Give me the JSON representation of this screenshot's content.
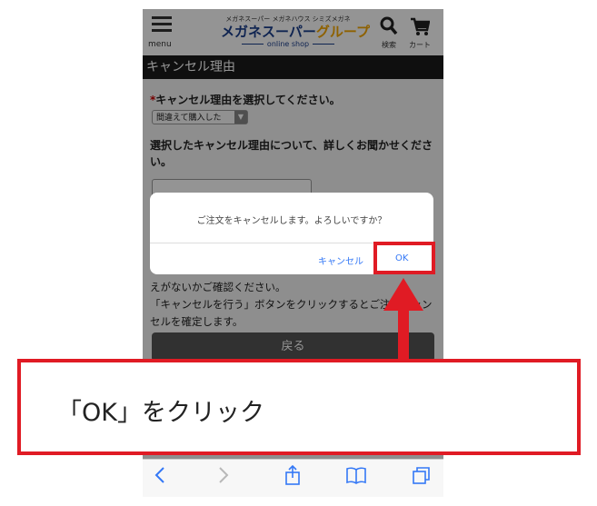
{
  "header": {
    "menu_label": "menu",
    "logo_sub": "メガネスーパー メガネハウス シミズメガネ",
    "logo_main": "メガネスーパー",
    "logo_accent": "グループ",
    "logo_online": "online shop",
    "search_label": "検索",
    "cart_label": "カート"
  },
  "section": {
    "title": "キャンセル理由"
  },
  "form": {
    "required_mark": "*",
    "reason_question": "キャンセル理由を選択してください。",
    "reason_selected": "間違えて購入した",
    "detail_question": "選択したキャンセル理由について、詳しくお聞かせください。",
    "notice_line1": "えがないかご確認ください。",
    "notice_line2": "「キャンセルを行う」ボタンをクリックするとご注文キャンセルを確定します。",
    "back_button": "戻る"
  },
  "dialog": {
    "message": "ご注文をキャンセルします。よろしいですか？",
    "cancel_button": "キャンセル",
    "ok_button": "OK"
  },
  "browser_toolbar": {
    "icons": [
      "back-icon",
      "forward-icon",
      "share-icon",
      "bookmarks-icon",
      "tabs-icon"
    ]
  },
  "annotation": {
    "callout_text": "「OK」をクリック",
    "highlight_color": "#e01b24"
  }
}
